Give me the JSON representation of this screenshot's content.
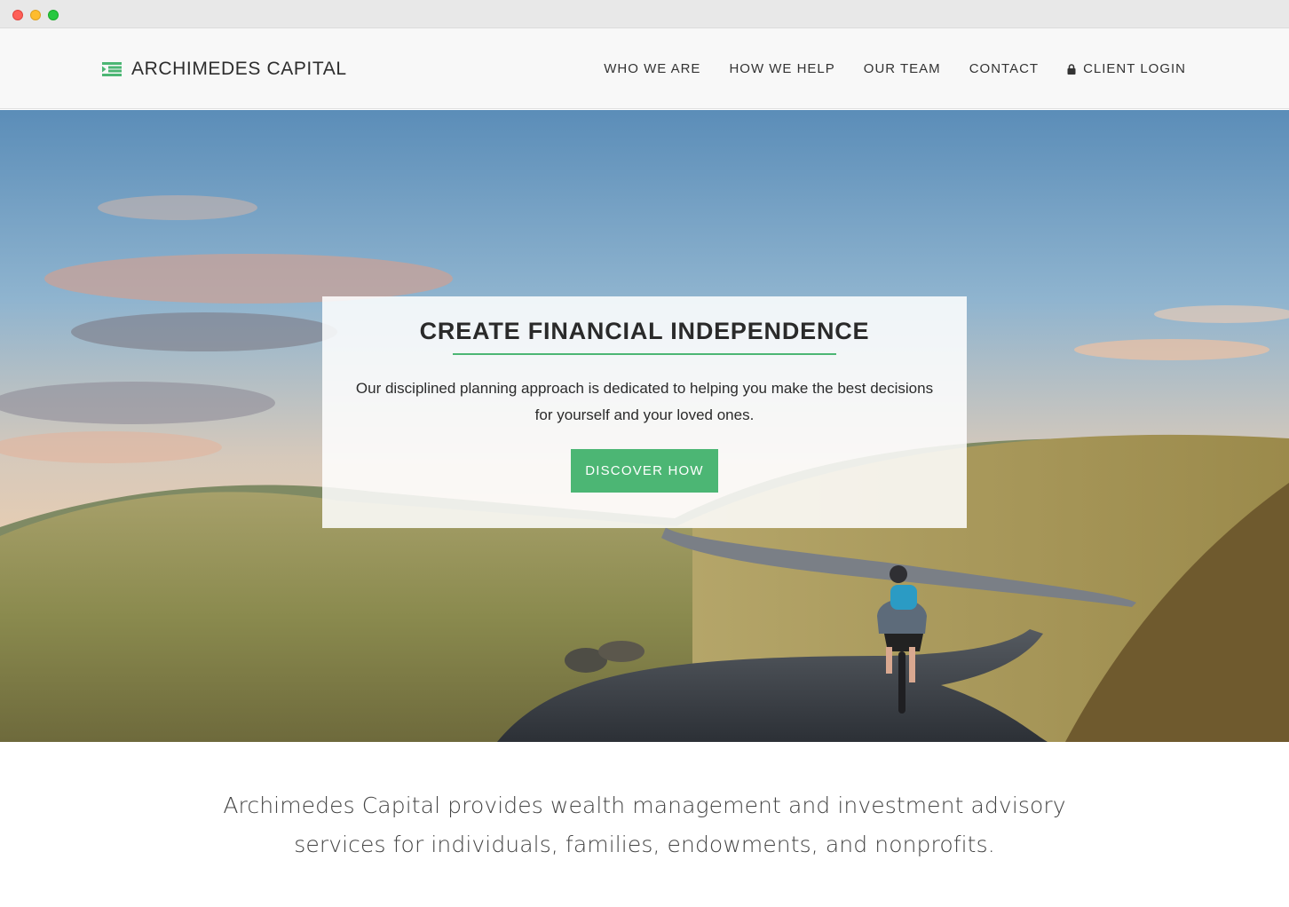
{
  "brand": {
    "name": "ARCHIMEDES CAPITAL",
    "icon": "menu-list-icon",
    "accent_color": "#4cb674"
  },
  "nav": {
    "items": [
      {
        "label": "WHO WE ARE"
      },
      {
        "label": "HOW WE HELP"
      },
      {
        "label": "OUR TEAM"
      },
      {
        "label": "CONTACT"
      },
      {
        "label": "CLIENT LOGIN",
        "icon": "lock-icon"
      }
    ]
  },
  "hero": {
    "title": "CREATE FINANCIAL INDEPENDENCE",
    "text": "Our disciplined planning approach is dedicated to helping you make the best decisions for yourself and your loved ones.",
    "button_label": "DISCOVER HOW",
    "image": "cyclist-on-mountain-road-photo"
  },
  "intro": {
    "text": "Archimedes Capital provides wealth management and investment advisory services for individuals, families, endowments, and nonprofits."
  }
}
